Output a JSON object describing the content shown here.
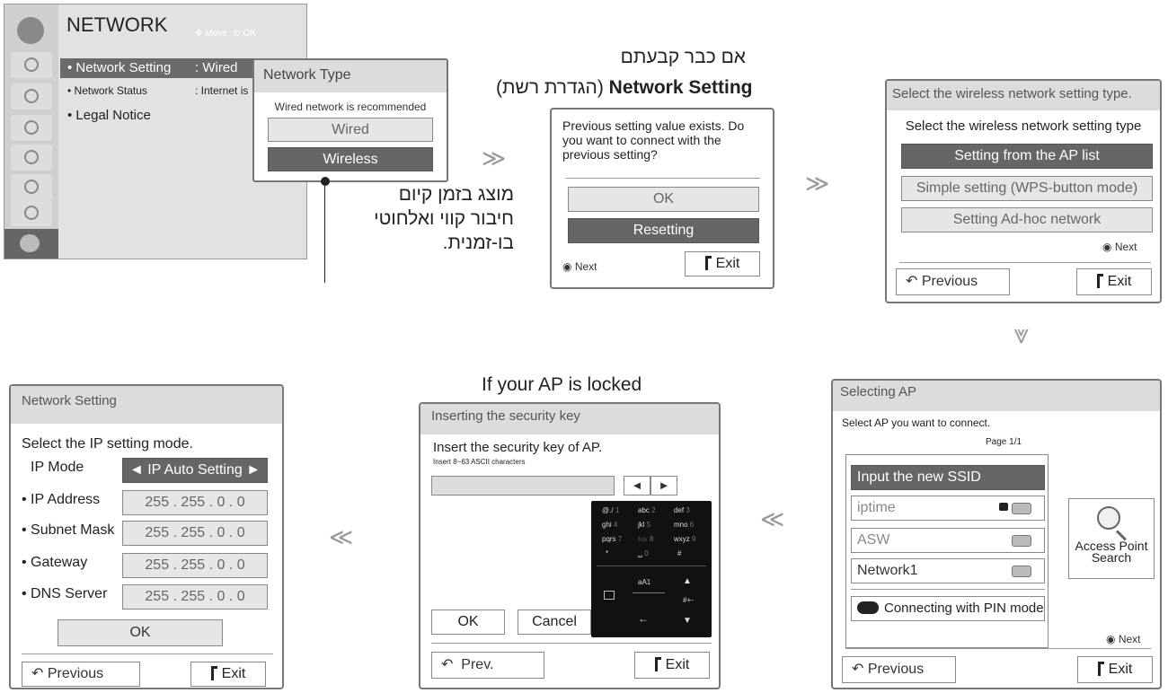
{
  "network_menu": {
    "title": "NETWORK",
    "hint_move": "Move",
    "hint_ok": "OK",
    "items": [
      {
        "label": "• Network Setting",
        "value": ": Wired"
      },
      {
        "label": "• Network Status",
        "value": ": Internet is"
      },
      {
        "label": "• Legal Notice",
        "value": ""
      }
    ],
    "popup": {
      "title": "Network Type",
      "note": "Wired network is recommended",
      "options": [
        "Wired",
        "Wireless"
      ]
    },
    "callout": [
      "מוצג בזמן קיום",
      "חיבור קווי ואלחוטי",
      "בו-זמנית."
    ]
  },
  "prev_setting": {
    "caption_line1": "אם כבר קבעתם",
    "caption_bold": "Network Setting",
    "caption_heb": "(הגדרת רשת)",
    "message": "Previous setting value exists. Do you want to connect with the previous setting?",
    "ok": "OK",
    "resetting": "Resetting",
    "next": "Next",
    "exit": "Exit"
  },
  "wireless_type": {
    "title": "Select the wireless network setting type.",
    "prompt": "Select the wireless network setting type",
    "options": [
      "Setting from the AP list",
      "Simple setting (WPS-button mode)",
      "Setting Ad-hoc network"
    ],
    "next": "Next",
    "previous": "Previous",
    "exit": "Exit"
  },
  "selecting_ap": {
    "title": "Selecting AP",
    "prompt": "Select AP you want to connect.",
    "page": "Page 1/1",
    "new_ssid": "Input the new SSID",
    "aps": [
      "iptime",
      "ASW",
      "Network1"
    ],
    "pin": "Connecting with PIN mode",
    "search": "Access Point Search",
    "next": "Next",
    "previous": "Previous",
    "exit": "Exit"
  },
  "security_key": {
    "caption": "If your AP is locked",
    "title": "Inserting the security key",
    "prompt": "Insert the security key of AP.",
    "hint": "Insert 8~63 ASCII characters",
    "keys": [
      "@./",
      "abc",
      "def",
      "ghi",
      "jkl",
      "mno",
      "pqrs",
      "tuv",
      "wxyz",
      "*",
      "␣",
      "#"
    ],
    "key_nums": [
      "1",
      "2",
      "3",
      "4",
      "5",
      "6",
      "7",
      "8",
      "9",
      "",
      "0",
      ""
    ],
    "ok": "OK",
    "cancel": "Cancel",
    "prev": "Prev.",
    "exit": "Exit",
    "case_key": "aA1",
    "sym_key": "#+-"
  },
  "ip_setting": {
    "title": "Network Setting",
    "prompt": "Select the IP setting mode.",
    "mode_label": "IP Mode",
    "mode_value": "◄ IP Auto Setting ►",
    "rows": [
      {
        "label": "• IP Address",
        "value": "255 . 255 . 0 . 0"
      },
      {
        "label": "• Subnet Mask",
        "value": "255 . 255 . 0 . 0"
      },
      {
        "label": "• Gateway",
        "value": "255 . 255 . 0 . 0"
      },
      {
        "label": "• DNS Server",
        "value": "255 . 255 . 0 . 0"
      }
    ],
    "ok": "OK",
    "previous": "Previous",
    "exit": "Exit"
  }
}
